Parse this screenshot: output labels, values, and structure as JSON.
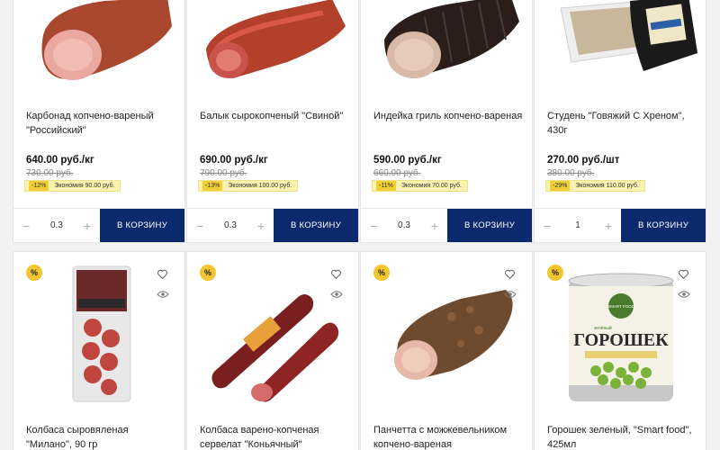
{
  "products_top": [
    {
      "name": "Карбонад копчено-вареный \"Российский\"",
      "price": "640.00 руб./кг",
      "old_price": "730.00 руб.",
      "discount_pct": "-12%",
      "economy": "Экономия 90.00 руб.",
      "qty": "0.3",
      "image_icon": "pork-loin-image"
    },
    {
      "name": "Балык сырокопченый \"Свиной\"",
      "price": "690.00 руб./кг",
      "old_price": "790.00 руб.",
      "discount_pct": "-13%",
      "economy": "Экономия 100.00 руб.",
      "qty": "0.3",
      "image_icon": "balyk-image"
    },
    {
      "name": "Индейка гриль копчено-вареная",
      "price": "590.00 руб./кг",
      "old_price": "660.00 руб.",
      "discount_pct": "-11%",
      "economy": "Экономия 70.00 руб.",
      "qty": "0.3",
      "image_icon": "turkey-roll-image"
    },
    {
      "name": "Студень \"Говяжий С Хреном\", 430г",
      "price": "270.00 руб./шт",
      "old_price": "380.00 руб.",
      "discount_pct": "-29%",
      "economy": "Экономия 110.00 руб.",
      "qty": "1",
      "image_icon": "aspic-tray-image"
    }
  ],
  "products_bottom": [
    {
      "name": "Колбаса сыровяленая \"Милано\", 90 гр",
      "badge": "%",
      "image_icon": "salami-pack-image"
    },
    {
      "name": "Колбаса варено-копченая сервелат \"Коньячный\"",
      "badge": "%",
      "image_icon": "servelat-image"
    },
    {
      "name": "Панчетта с можжевельником копчено-вареная",
      "badge": "%",
      "image_icon": "pancetta-image"
    },
    {
      "name": "Горошек зеленый, \"Smart food\", 425мл",
      "badge": "%",
      "image_icon": "peas-can-image"
    }
  ],
  "labels": {
    "minus": "−",
    "plus": "+",
    "add_to_cart": "В КОРЗИНУ"
  },
  "can_text": {
    "brand": "SMART FOOD",
    "small": "зелёный",
    "title": "ГОРОШЕК"
  },
  "colors": {
    "cart_button": "#0b2a6e",
    "badge": "#f3c52f",
    "economy_bg": "#fbf3b0"
  }
}
